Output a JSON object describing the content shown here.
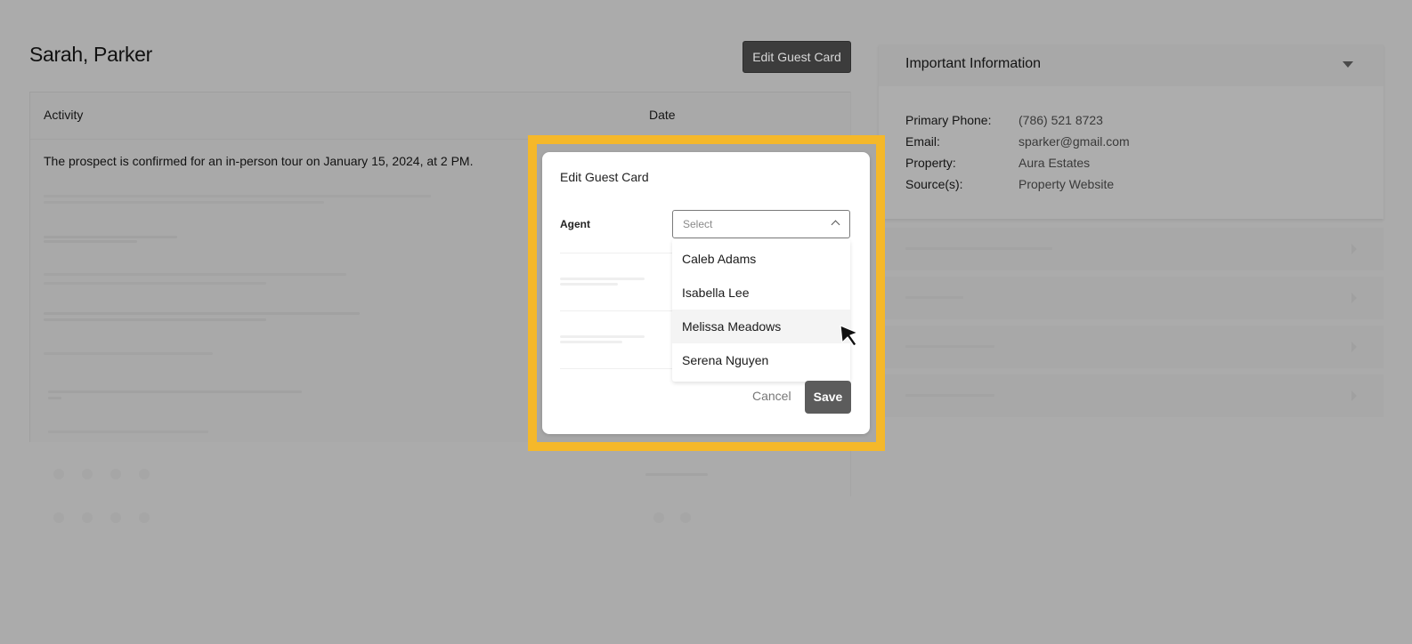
{
  "header": {
    "guest_name": "Sarah, Parker",
    "edit_button_label": "Edit Guest Card"
  },
  "activity": {
    "columns": [
      "Activity",
      "Date"
    ],
    "rows": [
      {
        "activity": "The prospect is confirmed for an in-person tour on January 15, 2024, at 2 PM."
      }
    ]
  },
  "important_info": {
    "title": "Important Information",
    "fields": [
      {
        "label": "Primary Phone:",
        "value": "(786) 521 8723"
      },
      {
        "label": "Email:",
        "value": "sparker@gmail.com"
      },
      {
        "label": "Property:",
        "value": "Aura Estates"
      },
      {
        "label": "Source(s):",
        "value": "Property Website"
      }
    ]
  },
  "modal": {
    "title": "Edit Guest Card",
    "agent_label": "Agent",
    "agent_placeholder": "Select",
    "agent_options": [
      "Caleb Adams",
      "Isabella Lee",
      "Melissa Meadows",
      "Serena Nguyen"
    ],
    "hovered_option": "Melissa Meadows",
    "cancel_label": "Cancel",
    "save_label": "Save"
  },
  "colors": {
    "highlight": "#f5b82a",
    "save_button": "#5c5c5c",
    "overlay": "#ababab"
  },
  "icons": [
    "chevron-down-icon",
    "chevron-up-icon",
    "chevron-right-icon",
    "mouse-pointer-icon"
  ]
}
